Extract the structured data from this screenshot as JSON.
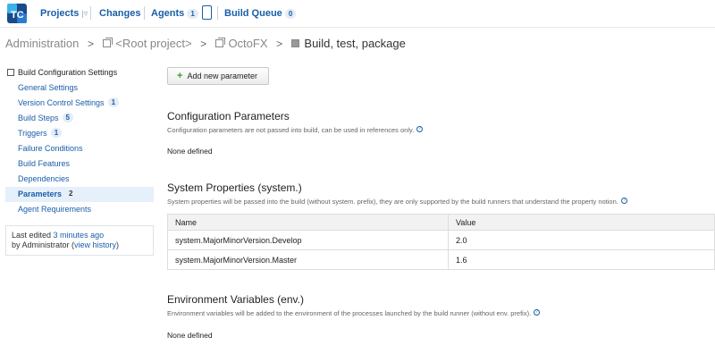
{
  "topnav": {
    "logo_text": "TC",
    "projects_label": "Projects",
    "changes_label": "Changes",
    "agents_label": "Agents",
    "agents_count": "1",
    "build_queue_label": "Build Queue",
    "build_queue_count": "0"
  },
  "breadcrumb": {
    "admin": "Administration",
    "root": "<Root project>",
    "project": "OctoFX",
    "build": "Build, test, package"
  },
  "sidebar": {
    "heading": "Build Configuration Settings",
    "items": [
      {
        "label": "General Settings",
        "badge": ""
      },
      {
        "label": "Version Control Settings",
        "badge": "1"
      },
      {
        "label": "Build Steps",
        "badge": "5"
      },
      {
        "label": "Triggers",
        "badge": "1"
      },
      {
        "label": "Failure Conditions",
        "badge": ""
      },
      {
        "label": "Build Features",
        "badge": ""
      },
      {
        "label": "Dependencies",
        "badge": ""
      },
      {
        "label": "Parameters",
        "badge": "2"
      },
      {
        "label": "Agent Requirements",
        "badge": ""
      }
    ],
    "active_index": 7,
    "last_edited_prefix": "Last edited ",
    "last_edited_time": "3 minutes ago",
    "last_edited_by": "by Administrator (",
    "view_history": "view history",
    "last_edited_close": ")"
  },
  "main": {
    "add_button": "Add new parameter",
    "config": {
      "title": "Configuration Parameters",
      "desc": "Configuration parameters are not passed into build, can be used in references only.",
      "empty": "None defined"
    },
    "system": {
      "title": "System Properties (system.)",
      "desc": "System properties will be passed into the build (without system. prefix), they are only supported by the build runners that understand the property notion.",
      "col_name": "Name",
      "col_value": "Value",
      "rows": [
        {
          "name": "system.MajorMinorVersion.Develop",
          "value": "2.0"
        },
        {
          "name": "system.MajorMinorVersion.Master",
          "value": "1.6"
        }
      ]
    },
    "env": {
      "title": "Environment Variables (env.)",
      "desc": "Environment variables will be added to the environment of the processes launched by the build runner (without env. prefix).",
      "empty": "None defined"
    },
    "help_glyph": "?"
  },
  "colors": {
    "link": "#1a5ea8",
    "active_bg": "#e6f0fb",
    "add_plus": "#3a9a2c"
  }
}
